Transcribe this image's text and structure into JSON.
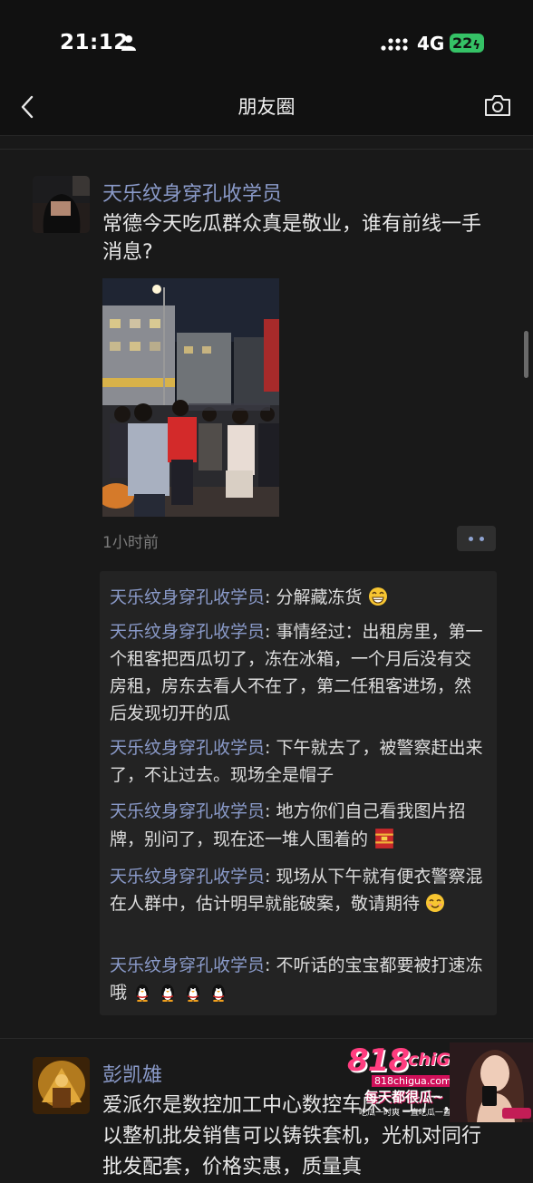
{
  "status_bar": {
    "time": "21:12",
    "network": "4G",
    "battery": "22"
  },
  "nav": {
    "title": "朋友圈"
  },
  "post1": {
    "author": "天乐纹身穿孔收学员",
    "text": "常德今天吃瓜群众真是敬业，谁有前线一手消息?",
    "time_ago": "1小时前",
    "comments": [
      {
        "name": "天乐纹身穿孔收学员",
        "sep": ": ",
        "text": "分解藏冻货",
        "emoji": "grin-emoji"
      },
      {
        "name": "天乐纹身穿孔收学员",
        "sep": ": ",
        "text": "事情经过：出租房里，第一个租客把西瓜切了，冻在冰箱，一个月后没有交房租，房东去看人不在了，第二任租客进场，然后发现切开的瓜"
      },
      {
        "name": "天乐纹身穿孔收学员",
        "sep": ": ",
        "text": "下午就去了，被警察赶出来了，不让过去。现场全是帽子"
      },
      {
        "name": "天乐纹身穿孔收学员",
        "sep": ": ",
        "text": "地方你们自己看我图片招牌，别问了，现在还一堆人围着的",
        "emoji": "firecracker-emoji"
      },
      {
        "name": "天乐纹身穿孔收学员",
        "sep": ": ",
        "text": "现场从下午就有便衣警察混在人群中，估计明早就能破案，敬请期待",
        "emoji": "smile-emoji"
      },
      {
        "name": "天乐纹身穿孔收学员",
        "sep": ": ",
        "text": "不听话的宝宝都要被打速冻哦",
        "emoji": "penguin-emoji"
      }
    ]
  },
  "post2": {
    "author": "彭凯雄",
    "text": "爱派尔是数控加工中心数控车床、工厂，可以整机批发销售可以铸铁套机，光机对同行批发配套，价格实惠，质量真"
  },
  "watermark": {
    "brand": "818",
    "brand2": "chiGUA",
    "url": "818chigua.com",
    "slogan": "每天都很瓜~",
    "sub": "吃瓜一时爽 一直吃瓜一直爽!"
  }
}
